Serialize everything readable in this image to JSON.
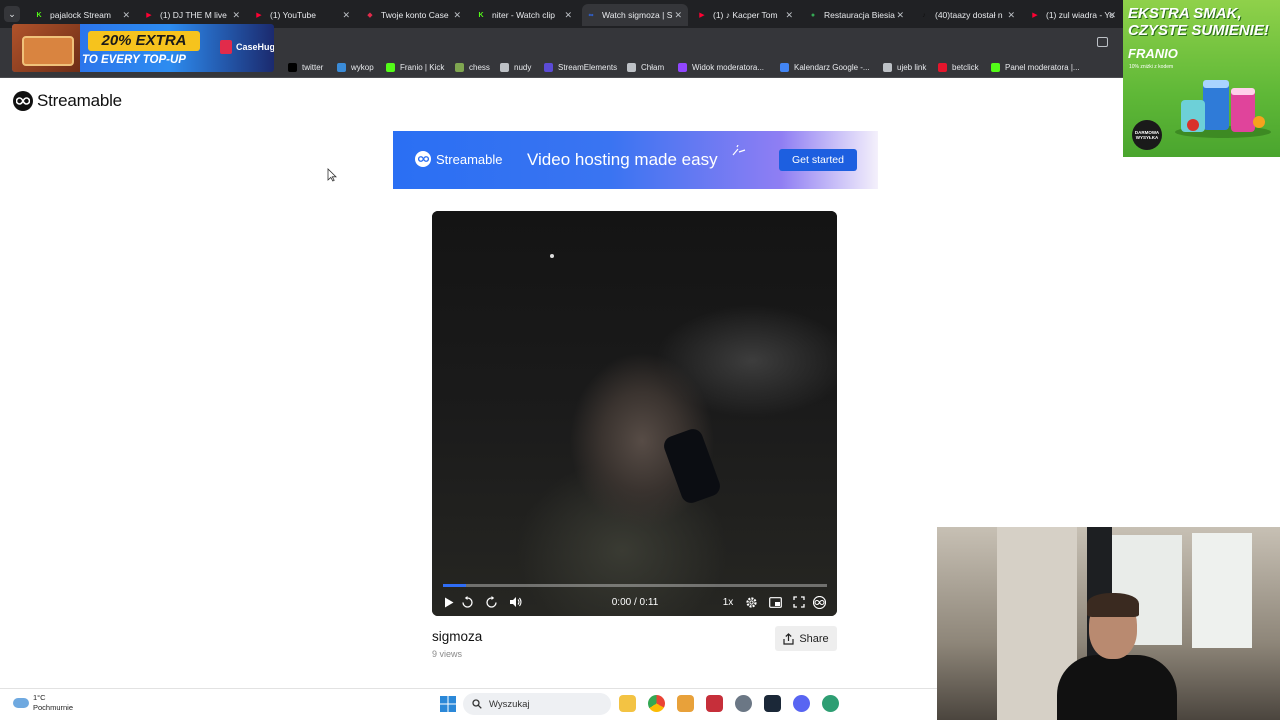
{
  "browser": {
    "tabs": [
      {
        "title": "pajalock Stream",
        "color": "#53fc18",
        "glyph": "K"
      },
      {
        "title": "(1) DJ THE M live",
        "color": "#ff0033",
        "glyph": "▶"
      },
      {
        "title": "(1) YouTube",
        "color": "#ff0033",
        "glyph": "▶"
      },
      {
        "title": "Twoje konto Case",
        "color": "#e12b4b",
        "glyph": "◆"
      },
      {
        "title": "niter - Watch clip",
        "color": "#53fc18",
        "glyph": "K"
      },
      {
        "title": "Watch sigmoza | S",
        "color": "#2f6df6",
        "glyph": "∞"
      },
      {
        "title": "(1) ♪ Kacper Tom",
        "color": "#ff0033",
        "glyph": "▶"
      },
      {
        "title": "Restauracja Biesia",
        "color": "#34a853",
        "glyph": "●"
      },
      {
        "title": "(40)taazy dostał n",
        "color": "#111111",
        "glyph": "♪"
      },
      {
        "title": "(1) zul wiadra - Yo",
        "color": "#ff0033",
        "glyph": "▶"
      }
    ],
    "bookmarks": [
      {
        "label": "twitter",
        "color": "#000000"
      },
      {
        "label": "wykop",
        "color": "#3a8bd8"
      },
      {
        "label": "Franio | Kick",
        "color": "#53fc18"
      },
      {
        "label": "chess",
        "color": "#7fa650"
      },
      {
        "label": "nudy",
        "color": "#bdc1c6"
      },
      {
        "label": "StreamElements",
        "color": "#5b4bd6"
      },
      {
        "label": "Chłam",
        "color": "#bdc1c6"
      },
      {
        "label": "Widok moderatora...",
        "color": "#9146ff"
      },
      {
        "label": "Kalendarz Google -...",
        "color": "#4285f4"
      },
      {
        "label": "ujeb link",
        "color": "#bdc1c6"
      },
      {
        "label": "betclick",
        "color": "#e5152c"
      },
      {
        "label": "Panel moderatora |...",
        "color": "#53fc18"
      }
    ]
  },
  "ads": {
    "left": {
      "extra": "20% EXTRA",
      "topup": "TO EVERY TOP-UP",
      "brand": "CaseHug"
    },
    "right": {
      "headline": "EKSTRA SMAK, CZYSTE SUMIENIE!",
      "brand": "FRANIO",
      "sub": "10% zniżki z kodem",
      "badge": "DARMOWA WYSYŁKA"
    }
  },
  "page": {
    "logo": "Streamable",
    "banner": {
      "logo": "Streamable",
      "tagline": "Video hosting made easy",
      "cta": "Get started"
    },
    "player": {
      "progress": 0.06,
      "time": "0:00 / 0:11",
      "speed": "1x"
    },
    "video": {
      "title": "sigmoza",
      "views": "9 views",
      "share": "Share"
    }
  },
  "taskbar": {
    "temperature": "1°C",
    "condition": "Pochmurnie",
    "search_placeholder": "Wyszukaj"
  },
  "colors": {
    "accent": "#2f6df6",
    "banner_button": "#1d5fe0",
    "tab_bar": "#202124"
  }
}
